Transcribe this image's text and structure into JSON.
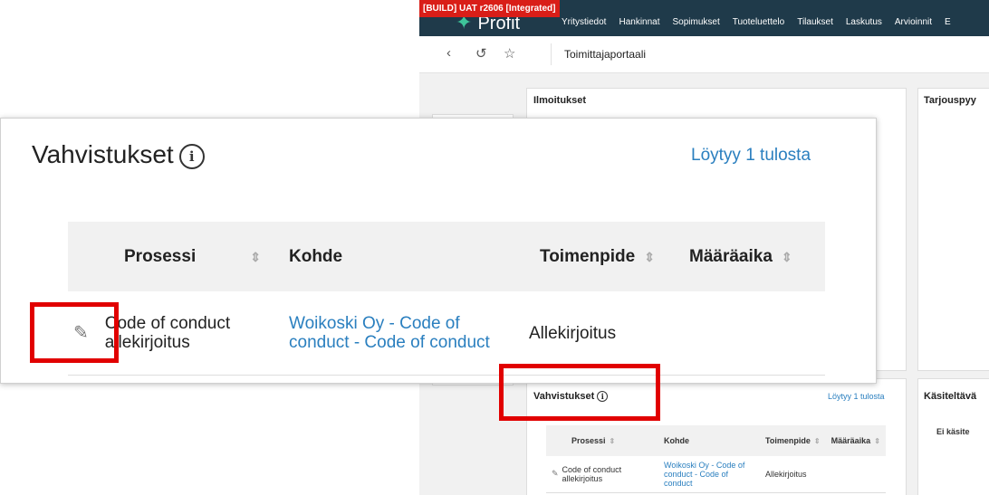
{
  "app": {
    "build_badge": "[BUILD] UAT r2606 [Integrated]",
    "logo": "Profit",
    "nav": [
      "Yritystiedot",
      "Hankinnat",
      "Sopimukset",
      "Tuoteluettelo",
      "Tilaukset",
      "Laskutus",
      "Arvioinnit",
      "E"
    ],
    "breadcrumb_title": "Toimittajaportaali"
  },
  "cards": {
    "ilmoitukset": "Ilmoitukset",
    "tarjouspyynnot": "Tarjouspyy",
    "kasiteltavat": "Käsiteltävä",
    "kasiteltavat_empty": "Ei käsite"
  },
  "vahvistukset": {
    "title": "Vahvistukset",
    "info_icon": "i",
    "result_count": "Löytyy 1 tulosta",
    "columns": [
      "Prosessi",
      "Kohde",
      "Toimenpide",
      "Määräaika"
    ],
    "row": {
      "prosessi": "Code of conduct allekirjoitus",
      "kohde": "Woikoski Oy - Code of conduct - Code of conduct",
      "toimenpide": "Allekirjoitus",
      "maaraaika": ""
    }
  },
  "colors": {
    "nav_bg": "#1f3a4a",
    "highlight": "#e10000",
    "link": "#2a7fbf",
    "badge": "#d91e18"
  }
}
